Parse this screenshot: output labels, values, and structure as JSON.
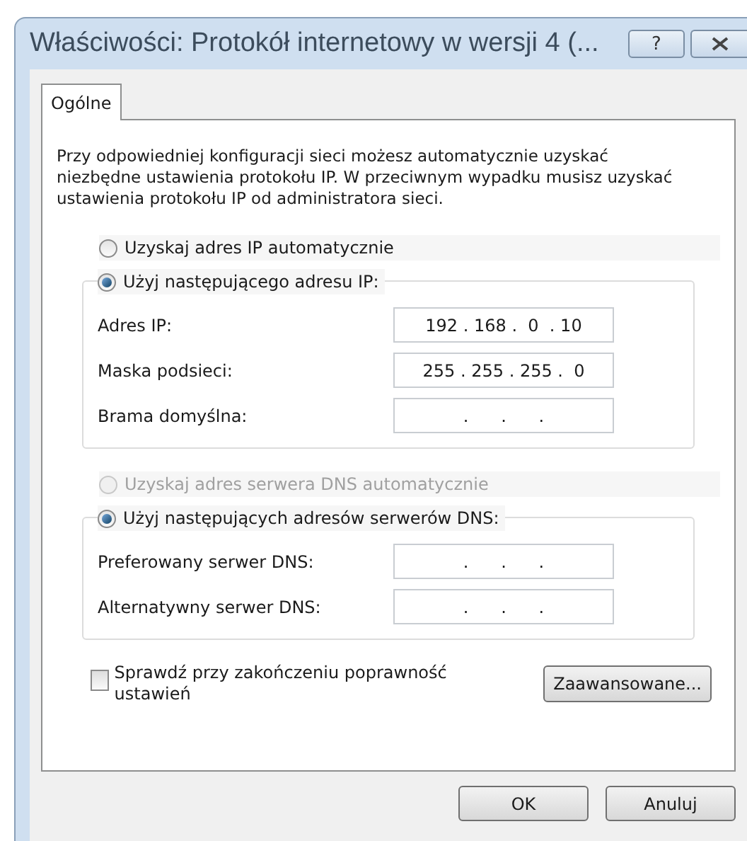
{
  "window": {
    "title": "Właściwości: Protokół internetowy w wersji 4 (...",
    "help_button": "?"
  },
  "tabs": [
    {
      "label": "Ogólne",
      "selected": true
    }
  ],
  "intro": "Przy odpowiedniej konfiguracji sieci możesz automatycznie uzyskać niezbędne ustawienia protokołu IP. W przeciwnym wypadku musisz uzyskać ustawienia protokołu IP od administratora sieci.",
  "sections": [
    {
      "auto_option": {
        "label": "Uzyskaj adres IP automatycznie",
        "selected": false,
        "disabled": false
      },
      "manual_option": {
        "label": "Użyj następującego adresu IP:",
        "selected": true,
        "disabled": false
      },
      "fields": [
        {
          "label": "Adres IP:",
          "value": "192 . 168 .  0  . 10"
        },
        {
          "label": "Maska podsieci:",
          "value": "255 . 255 . 255 .  0"
        },
        {
          "label": "Brama domyślna:",
          "value": "     .      .      .     "
        }
      ]
    },
    {
      "auto_option": {
        "label": "Uzyskaj adres serwera DNS automatycznie",
        "selected": false,
        "disabled": true
      },
      "manual_option": {
        "label": "Użyj następujących adresów serwerów DNS:",
        "selected": true,
        "disabled": false
      },
      "fields": [
        {
          "label": "Preferowany serwer DNS:",
          "value": "     .      .      .     "
        },
        {
          "label": "Alternatywny serwer DNS:",
          "value": "     .      .      .     "
        }
      ]
    }
  ],
  "validate_checkbox": {
    "label": "Sprawdź przy zakończeniu poprawność ustawień",
    "checked": false
  },
  "advanced_button": "Zaawansowane...",
  "buttons": [
    "OK",
    "Anuluj"
  ]
}
